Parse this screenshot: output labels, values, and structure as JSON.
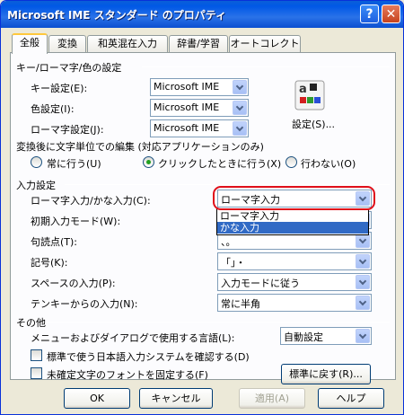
{
  "window": {
    "title": "Microsoft IME スタンダード のプロパティ",
    "help_glyph": "?",
    "close_glyph": "✕"
  },
  "tabs": [
    {
      "label": "全般",
      "active": true
    },
    {
      "label": "変換",
      "active": false
    },
    {
      "label": "和英混在入力",
      "active": false
    },
    {
      "label": "辞書/学習",
      "active": false
    },
    {
      "label": "オートコレクト",
      "active": false
    }
  ],
  "key_section": {
    "title": "キー/ローマ字/色の設定",
    "rows": [
      {
        "label": "キー設定(E):",
        "value": "Microsoft IME"
      },
      {
        "label": "色設定(I):",
        "value": "Microsoft IME"
      },
      {
        "label": "ローマ字設定(J):",
        "value": "Microsoft IME"
      }
    ],
    "settings_button": "設定(S)..."
  },
  "edit_section": {
    "title": "変換後に文字単位での編集 (対応アプリケーションのみ)",
    "options": [
      {
        "label": "常に行う(U)",
        "selected": false
      },
      {
        "label": "クリックしたときに行う(X)",
        "selected": true
      },
      {
        "label": "行わない(O)",
        "selected": false
      }
    ]
  },
  "input_section": {
    "title": "入力設定",
    "rows": [
      {
        "label": "ローマ字入力/かな入力(C):",
        "value": "ローマ字入力"
      },
      {
        "label": "初期入力モード(W):",
        "value": ""
      },
      {
        "label": "句読点(T):",
        "value": "、。"
      },
      {
        "label": "記号(K):",
        "value": "「」・"
      },
      {
        "label": "スペースの入力(P):",
        "value": "入力モードに従う"
      },
      {
        "label": "テンキーからの入力(N):",
        "value": "常に半角"
      }
    ],
    "open_dropdown": {
      "items": [
        "ローマ字入力",
        "かな入力"
      ],
      "selected_index": 1
    }
  },
  "other_section": {
    "title": "その他",
    "language_label": "メニューおよびダイアログで使用する言語(L):",
    "language_value": "自動設定",
    "checkboxes": [
      {
        "label": "標準で使う日本語入力システムを確認する(D)",
        "checked": false
      },
      {
        "label": "未確定文字のフォントを固定する(F)",
        "checked": false
      }
    ],
    "reset_button": "標準に戻す(R)..."
  },
  "footer": {
    "ok": "OK",
    "cancel": "キャンセル",
    "apply": "適用(A)",
    "help": "ヘルプ"
  },
  "colors": {
    "titlebar": "#0058e6",
    "highlight_ring": "#e0101a",
    "selection": "#316ac5"
  }
}
